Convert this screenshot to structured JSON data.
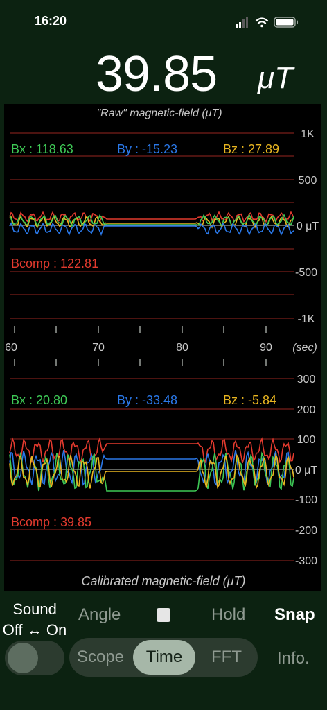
{
  "status": {
    "time": "16:20"
  },
  "reading": {
    "value": "39.85",
    "unit": "μT"
  },
  "raw": {
    "title": "\"Raw\" magnetic-field (μT)",
    "bx": "Bx : 118.63",
    "by": "By : -15.23",
    "bz": "Bz : 27.89",
    "bcomp": "Bcomp : 122.81",
    "y_ticks": [
      "1K",
      "500",
      "0 μT",
      "-500",
      "-1K"
    ]
  },
  "time_axis": {
    "ticks": [
      "60",
      "70",
      "80",
      "90"
    ],
    "unit": "(sec)"
  },
  "calibrated": {
    "title": "Calibrated magnetic-field (μT)",
    "bx": "Bx : 20.80",
    "by": "By : -33.48",
    "bz": "Bz : -5.84",
    "bcomp": "Bcomp : 39.85",
    "y_ticks": [
      "300",
      "200",
      "100",
      "0 μT",
      "-100",
      "-200",
      "-300"
    ]
  },
  "controls": {
    "sound_line1": "Sound",
    "sound_line2": "Off ↔ On",
    "angle": "Angle",
    "hold": "Hold",
    "snap": "Snap",
    "info": "Info.",
    "modes": [
      "Scope",
      "Time",
      "FFT"
    ],
    "selected_mode": "Time"
  },
  "colors": {
    "bx": "#3ec956",
    "by": "#2a78e8",
    "bz": "#e8b520",
    "bcomp": "#e23a2e",
    "grid": "#7a1f1a"
  },
  "chart_data": [
    {
      "type": "line",
      "title": "\"Raw\" magnetic-field (μT)",
      "xlabel": "(sec)",
      "ylabel": "",
      "xlim": [
        58,
        94
      ],
      "ylim": [
        -1000,
        1000
      ],
      "series": [
        {
          "name": "Bx",
          "latest": 118.63
        },
        {
          "name": "By",
          "latest": -15.23
        },
        {
          "name": "Bz",
          "latest": 27.89
        },
        {
          "name": "Bcomp",
          "latest": 122.81
        }
      ]
    },
    {
      "type": "line",
      "title": "Calibrated magnetic-field (μT)",
      "xlabel": "(sec)",
      "ylabel": "",
      "xlim": [
        58,
        94
      ],
      "ylim": [
        -300,
        300
      ],
      "series": [
        {
          "name": "Bx",
          "latest": 20.8
        },
        {
          "name": "By",
          "latest": -33.48
        },
        {
          "name": "Bz",
          "latest": -5.84
        },
        {
          "name": "Bcomp",
          "latest": 39.85
        }
      ]
    }
  ]
}
